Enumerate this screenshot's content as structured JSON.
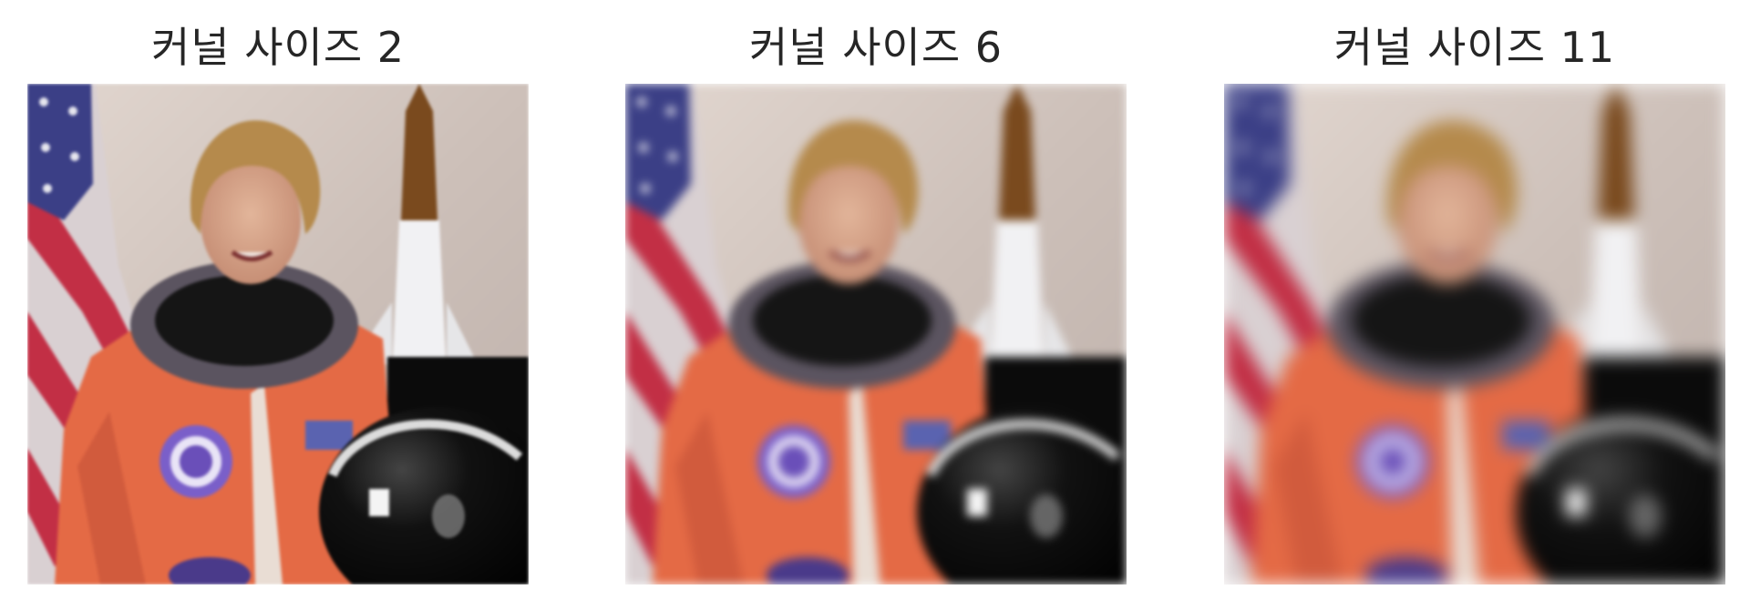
{
  "figure": {
    "panels": [
      {
        "title": "커널 사이즈 2",
        "kernel_size": 2
      },
      {
        "title": "커널 사이즈 6",
        "kernel_size": 6
      },
      {
        "title": "커널 사이즈 11",
        "kernel_size": 11
      }
    ]
  },
  "colors": {
    "background_wall": "#cdc0b9",
    "suit_orange": "#e46a45",
    "helmet_black": "#0b0b0b",
    "flag_red": "#c22f45",
    "flag_blue": "#3b3f86",
    "hair_blond": "#b58a4c",
    "patch_purple": "#7a5fc9"
  }
}
